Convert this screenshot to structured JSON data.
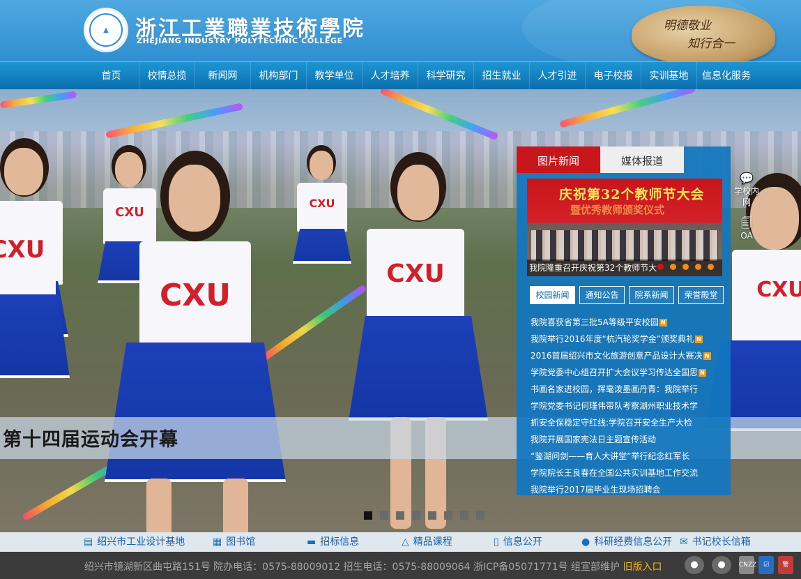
{
  "header": {
    "school_name_cn": "浙江工業職業技術學院",
    "school_name_en": "ZHEJIANG INDUSTRY POLYTECHNIC COLLEGE",
    "motto_line1": "明德敬业",
    "motto_line2": "知行合一"
  },
  "nav": {
    "items": [
      "首页",
      "校情总揽",
      "新闻网",
      "机构部门",
      "教学单位",
      "人才培养",
      "科学研究",
      "招生就业",
      "人才引进",
      "电子校报",
      "实训基地",
      "信息化服务"
    ]
  },
  "hero": {
    "caption": "第十四届运动会开幕",
    "shirt_text": "CXU",
    "slides_total": 8,
    "active_slide": 1
  },
  "side_links": {
    "intranet_label": "学校内网",
    "oa_label": "OA",
    "intranet_icon": "chat-bubble-icon",
    "oa_icon": "document-icon"
  },
  "news_panel": {
    "tabs": [
      "图片新闻",
      "媒体报道"
    ],
    "photo": {
      "banner_text": "庆祝第32个教师节大会",
      "banner_sub": "暨优秀教师颁奖仪式",
      "caption": "我院隆重召开庆祝第32个教师节大",
      "dots": 5
    },
    "subtabs": [
      "校园新闻",
      "通知公告",
      "院系新闻",
      "荣誉殿堂"
    ],
    "news": [
      {
        "title": "我院喜获省第三批5A等级平安校园",
        "new": true
      },
      {
        "title": "我院举行2016年度“杭汽轮奖学金”颁奖典礼",
        "new": true
      },
      {
        "title": "2016首届绍兴市文化旅游创意产品设计大赛决",
        "new": true
      },
      {
        "title": "学院党委中心组召开扩大会议学习传达全国思",
        "new": true
      },
      {
        "title": "书画名家进校园，挥毫泼墨画丹青：我院举行",
        "new": false
      },
      {
        "title": "学院党委书记何瑾伟带队考察湖州职业技术学",
        "new": false
      },
      {
        "title": "抓安全保稳定守红线:学院召开安全生产大检",
        "new": false
      },
      {
        "title": "我院开展国家宪法日主题宣传活动",
        "new": false
      },
      {
        "title": "“鉴湖问剑——育人大讲堂”举行纪念红军长",
        "new": false
      },
      {
        "title": "学院院长王良春在全国公共实训基地工作交流",
        "new": false
      },
      {
        "title": "我院举行2017届毕业生现场招聘会",
        "new": false
      }
    ],
    "new_badge": "N"
  },
  "quick_links": [
    {
      "label": "绍兴市工业设计基地",
      "icon": "window-icon"
    },
    {
      "label": "图书馆",
      "icon": "building-icon"
    },
    {
      "label": "招标信息",
      "icon": "card-icon"
    },
    {
      "label": "精品课程",
      "icon": "flask-icon"
    },
    {
      "label": "信息公开",
      "icon": "phone-icon"
    },
    {
      "label": "科研经费信息公开",
      "icon": "bulb-icon"
    },
    {
      "label": "书记校长信箱",
      "icon": "mail-icon"
    }
  ],
  "footer": {
    "text": "绍兴市镜湖新区曲屯路151号 院办电话：0575-88009012 招生电话：0575-88009064 浙ICP备05071771号 组宣部维护",
    "old_version": "旧版入口",
    "badges": [
      "CNZZ",
      "警"
    ]
  },
  "colors": {
    "nav_blue": "#0c6fae",
    "panel_blue": "#1276bf",
    "tab_red": "#c8161d",
    "footer_bg": "#3b3b3b",
    "old_version_orange": "#f2b21a"
  }
}
